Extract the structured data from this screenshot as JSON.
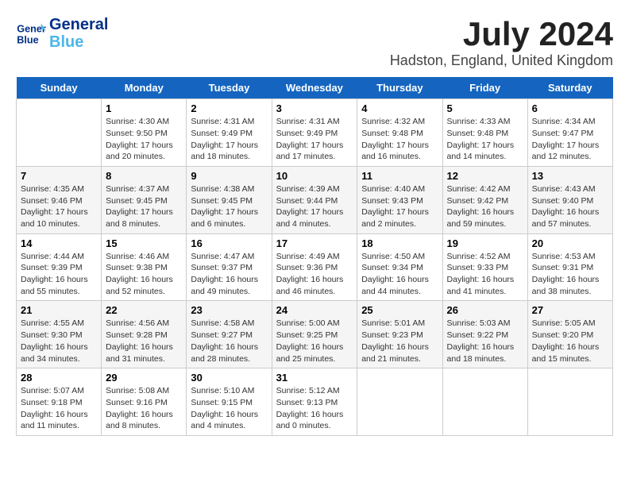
{
  "header": {
    "logo_line1": "General",
    "logo_line2": "Blue",
    "month_year": "July 2024",
    "location": "Hadston, England, United Kingdom"
  },
  "days_of_week": [
    "Sunday",
    "Monday",
    "Tuesday",
    "Wednesday",
    "Thursday",
    "Friday",
    "Saturday"
  ],
  "weeks": [
    [
      {
        "date": "",
        "info": ""
      },
      {
        "date": "1",
        "info": "Sunrise: 4:30 AM\nSunset: 9:50 PM\nDaylight: 17 hours\nand 20 minutes."
      },
      {
        "date": "2",
        "info": "Sunrise: 4:31 AM\nSunset: 9:49 PM\nDaylight: 17 hours\nand 18 minutes."
      },
      {
        "date": "3",
        "info": "Sunrise: 4:31 AM\nSunset: 9:49 PM\nDaylight: 17 hours\nand 17 minutes."
      },
      {
        "date": "4",
        "info": "Sunrise: 4:32 AM\nSunset: 9:48 PM\nDaylight: 17 hours\nand 16 minutes."
      },
      {
        "date": "5",
        "info": "Sunrise: 4:33 AM\nSunset: 9:48 PM\nDaylight: 17 hours\nand 14 minutes."
      },
      {
        "date": "6",
        "info": "Sunrise: 4:34 AM\nSunset: 9:47 PM\nDaylight: 17 hours\nand 12 minutes."
      }
    ],
    [
      {
        "date": "7",
        "info": "Sunrise: 4:35 AM\nSunset: 9:46 PM\nDaylight: 17 hours\nand 10 minutes."
      },
      {
        "date": "8",
        "info": "Sunrise: 4:37 AM\nSunset: 9:45 PM\nDaylight: 17 hours\nand 8 minutes."
      },
      {
        "date": "9",
        "info": "Sunrise: 4:38 AM\nSunset: 9:45 PM\nDaylight: 17 hours\nand 6 minutes."
      },
      {
        "date": "10",
        "info": "Sunrise: 4:39 AM\nSunset: 9:44 PM\nDaylight: 17 hours\nand 4 minutes."
      },
      {
        "date": "11",
        "info": "Sunrise: 4:40 AM\nSunset: 9:43 PM\nDaylight: 17 hours\nand 2 minutes."
      },
      {
        "date": "12",
        "info": "Sunrise: 4:42 AM\nSunset: 9:42 PM\nDaylight: 16 hours\nand 59 minutes."
      },
      {
        "date": "13",
        "info": "Sunrise: 4:43 AM\nSunset: 9:40 PM\nDaylight: 16 hours\nand 57 minutes."
      }
    ],
    [
      {
        "date": "14",
        "info": "Sunrise: 4:44 AM\nSunset: 9:39 PM\nDaylight: 16 hours\nand 55 minutes."
      },
      {
        "date": "15",
        "info": "Sunrise: 4:46 AM\nSunset: 9:38 PM\nDaylight: 16 hours\nand 52 minutes."
      },
      {
        "date": "16",
        "info": "Sunrise: 4:47 AM\nSunset: 9:37 PM\nDaylight: 16 hours\nand 49 minutes."
      },
      {
        "date": "17",
        "info": "Sunrise: 4:49 AM\nSunset: 9:36 PM\nDaylight: 16 hours\nand 46 minutes."
      },
      {
        "date": "18",
        "info": "Sunrise: 4:50 AM\nSunset: 9:34 PM\nDaylight: 16 hours\nand 44 minutes."
      },
      {
        "date": "19",
        "info": "Sunrise: 4:52 AM\nSunset: 9:33 PM\nDaylight: 16 hours\nand 41 minutes."
      },
      {
        "date": "20",
        "info": "Sunrise: 4:53 AM\nSunset: 9:31 PM\nDaylight: 16 hours\nand 38 minutes."
      }
    ],
    [
      {
        "date": "21",
        "info": "Sunrise: 4:55 AM\nSunset: 9:30 PM\nDaylight: 16 hours\nand 34 minutes."
      },
      {
        "date": "22",
        "info": "Sunrise: 4:56 AM\nSunset: 9:28 PM\nDaylight: 16 hours\nand 31 minutes."
      },
      {
        "date": "23",
        "info": "Sunrise: 4:58 AM\nSunset: 9:27 PM\nDaylight: 16 hours\nand 28 minutes."
      },
      {
        "date": "24",
        "info": "Sunrise: 5:00 AM\nSunset: 9:25 PM\nDaylight: 16 hours\nand 25 minutes."
      },
      {
        "date": "25",
        "info": "Sunrise: 5:01 AM\nSunset: 9:23 PM\nDaylight: 16 hours\nand 21 minutes."
      },
      {
        "date": "26",
        "info": "Sunrise: 5:03 AM\nSunset: 9:22 PM\nDaylight: 16 hours\nand 18 minutes."
      },
      {
        "date": "27",
        "info": "Sunrise: 5:05 AM\nSunset: 9:20 PM\nDaylight: 16 hours\nand 15 minutes."
      }
    ],
    [
      {
        "date": "28",
        "info": "Sunrise: 5:07 AM\nSunset: 9:18 PM\nDaylight: 16 hours\nand 11 minutes."
      },
      {
        "date": "29",
        "info": "Sunrise: 5:08 AM\nSunset: 9:16 PM\nDaylight: 16 hours\nand 8 minutes."
      },
      {
        "date": "30",
        "info": "Sunrise: 5:10 AM\nSunset: 9:15 PM\nDaylight: 16 hours\nand 4 minutes."
      },
      {
        "date": "31",
        "info": "Sunrise: 5:12 AM\nSunset: 9:13 PM\nDaylight: 16 hours\nand 0 minutes."
      },
      {
        "date": "",
        "info": ""
      },
      {
        "date": "",
        "info": ""
      },
      {
        "date": "",
        "info": ""
      }
    ]
  ]
}
